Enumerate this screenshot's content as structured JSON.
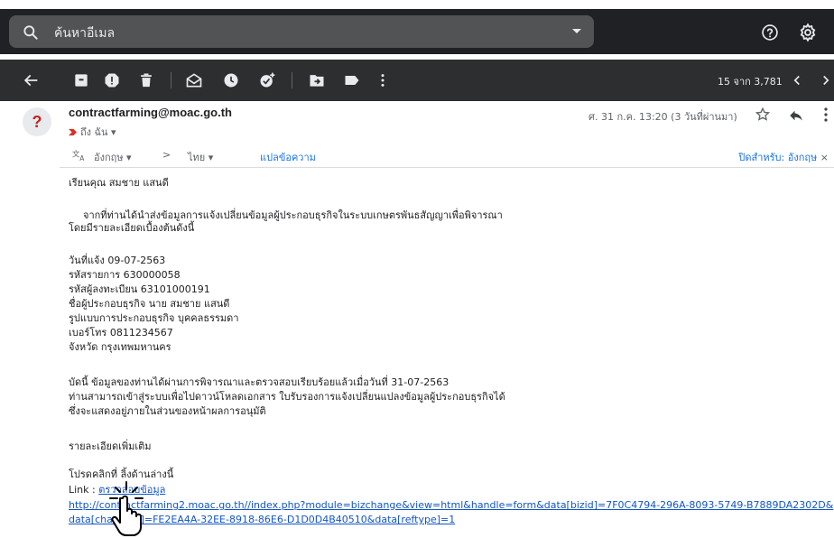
{
  "search": {
    "placeholder": "ค้นหาอีเมล"
  },
  "toolbar": {
    "pager_text": "15 จาก 3,781"
  },
  "email": {
    "avatar_letter": "?",
    "sender": "contractfarming@moac.go.th",
    "to_label": "ถึง ฉัน",
    "datetime": "ศ. 31 ก.ค. 13:20 (3 วันที่ผ่านมา)"
  },
  "translate": {
    "from_lang": "อังกฤษ",
    "arrow": ">",
    "to_lang": "ไทย",
    "action": "แปลข้อความ",
    "turn_off": "ปิดสำหรับ: อังกฤษ"
  },
  "body": {
    "greeting": "เรียนคุณ สมชาย แสนดี",
    "intro_line1": "จากที่ท่านได้นำส่งข้อมูลการแจ้งเปลี่ยนข้อมูลผู้ประกอบธุรกิจในระบบเกษตรพันธสัญญาเพื่อพิจารณา",
    "intro_line2": "โดยมีรายละเอียดเบื้องต้นดังนี้",
    "details": [
      "วันที่แจ้ง 09-07-2563",
      "รหัสรายการ 630000058",
      "รหัสผู้ลงทะเบียน 63101000191",
      "ชื่อผู้ประกอบธุรกิจ นาย สมชาย แสนดี",
      "รูปแบบการประกอบธุรกิจ บุคคลธรรมดา",
      "เบอร์โทร 0811234567",
      "จังหวัด กรุงเทพมหานคร"
    ],
    "status_line1": "บัดนี้ ข้อมูลของท่านได้ผ่านการพิจารณาและตรวจสอบเรียบร้อยแล้วเมื่อวันที่ 31-07-2563",
    "status_line2": "ท่านสามารถเข้าสู่ระบบเพื่อไปดาวน์โหลดเอกสาร ใบรับรองการแจ้งเปลี่ยนแปลงข้อมูลผู้ประกอบธุรกิจได้",
    "status_line3": "ซึ่งจะแสดงอยู่ภายในส่วนของหน้าผลการอนุมัติ",
    "more_details": "รายละเอียดเพิ่มเติม",
    "click_instruction": "โปรดคลิกที่ ลิ้งด้านล่างนี้",
    "link_label": "Link :",
    "link_text": "ตรวจสอบข้อมูล",
    "url_line1": "http://contractfarming2.moac.go.th//index.php?module=bizchange&view=html&handle=form&data[bizid]=7F0C4794-296A-8093-5749-B7889DA2302D&",
    "url_line2": "data[changeid]=FE2EA4A-32EE-8918-86E6-D1D0D4B40510&data[reftype]=1"
  }
}
